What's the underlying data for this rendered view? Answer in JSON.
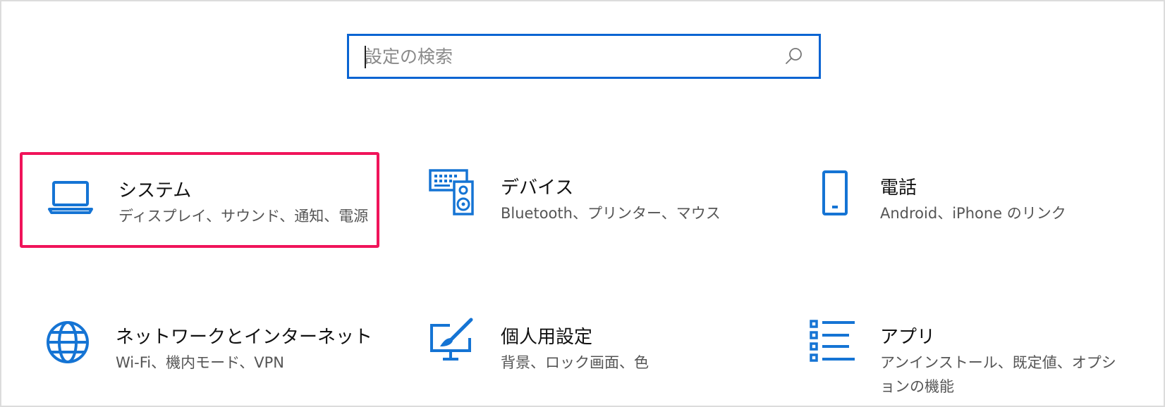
{
  "search": {
    "placeholder": "設定の検索",
    "icon": "search-icon"
  },
  "tiles": [
    {
      "id": "system",
      "title": "システム",
      "description": "ディスプレイ、サウンド、通知、電源",
      "icon": "laptop-icon",
      "selected": true
    },
    {
      "id": "devices",
      "title": "デバイス",
      "description": "Bluetooth、プリンター、マウス",
      "icon": "keyboard-speaker-icon",
      "selected": false
    },
    {
      "id": "phone",
      "title": "電話",
      "description": "Android、iPhone のリンク",
      "icon": "phone-icon",
      "selected": false
    },
    {
      "id": "network",
      "title": "ネットワークとインターネット",
      "description": "Wi-Fi、機内モード、VPN",
      "icon": "globe-icon",
      "selected": false
    },
    {
      "id": "personalization",
      "title": "個人用設定",
      "description": "背景、ロック画面、色",
      "icon": "paintbrush-monitor-icon",
      "selected": false
    },
    {
      "id": "apps",
      "title": "アプリ",
      "description": "アンインストール、既定値、オプションの機能",
      "icon": "apps-list-icon",
      "selected": false
    }
  ],
  "colors": {
    "accent": "#0a64d2",
    "selection": "#f0145a",
    "icon": "#1574d4"
  }
}
